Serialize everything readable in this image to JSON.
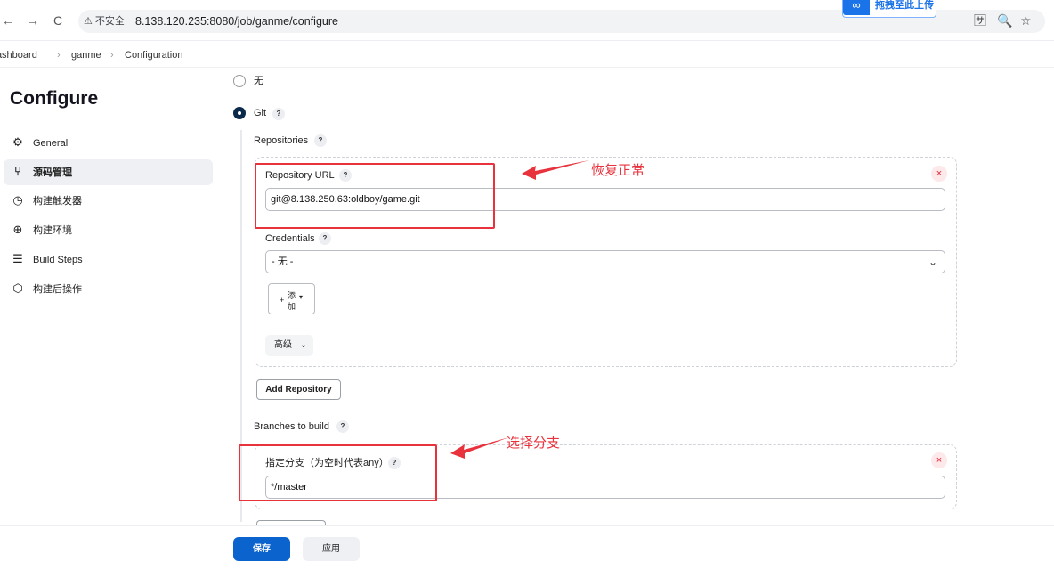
{
  "browser": {
    "back": "←",
    "forward": "→",
    "reload": "C",
    "insecure_label": "⚠ 不安全",
    "url": "8.138.120.235:8080/job/ganme/configure",
    "upload_extension": "拖拽至此上传",
    "translate_icon": "🈂",
    "zoom_icon": "🔍",
    "bookmark_icon": "☆"
  },
  "breadcrumb": [
    "Dashboard",
    "ganme",
    "Configuration"
  ],
  "sidebar": {
    "title": "Configure",
    "items": [
      {
        "label": "General",
        "icon": "gear-icon",
        "glyph": "⚙"
      },
      {
        "label": "源码管理",
        "icon": "branch-icon",
        "glyph": "⑂",
        "active": true
      },
      {
        "label": "构建触发器",
        "icon": "clock-icon",
        "glyph": "◷"
      },
      {
        "label": "构建环境",
        "icon": "globe-icon",
        "glyph": "⊕"
      },
      {
        "label": "Build Steps",
        "icon": "list-icon",
        "glyph": "☰"
      },
      {
        "label": "构建后操作",
        "icon": "cube-icon",
        "glyph": "⬡"
      }
    ]
  },
  "scm": {
    "option_none": "无",
    "option_git": "Git",
    "repositories_label": "Repositories",
    "repo_url_label": "Repository URL",
    "repo_url_value": "git@8.138.250.63:oldboy/game.git",
    "credentials_label": "Credentials",
    "credentials_value": "- 无 -",
    "add_button_plus": "+",
    "add_button_label_1": "添",
    "add_button_label_2": "加",
    "add_button_caret": "▾",
    "advanced_label": "高级",
    "add_repository_label": "Add Repository",
    "branches_label": "Branches to build",
    "branch_specifier_label": "指定分支（为空时代表any）",
    "branch_value": "*/master"
  },
  "help_glyph": "?",
  "close_glyph": "×",
  "annotations": {
    "repo_note": "恢复正常",
    "branch_note": "选择分支",
    "color": "#e8323c"
  },
  "footer": {
    "save_label": "保存",
    "apply_label": "应用"
  }
}
